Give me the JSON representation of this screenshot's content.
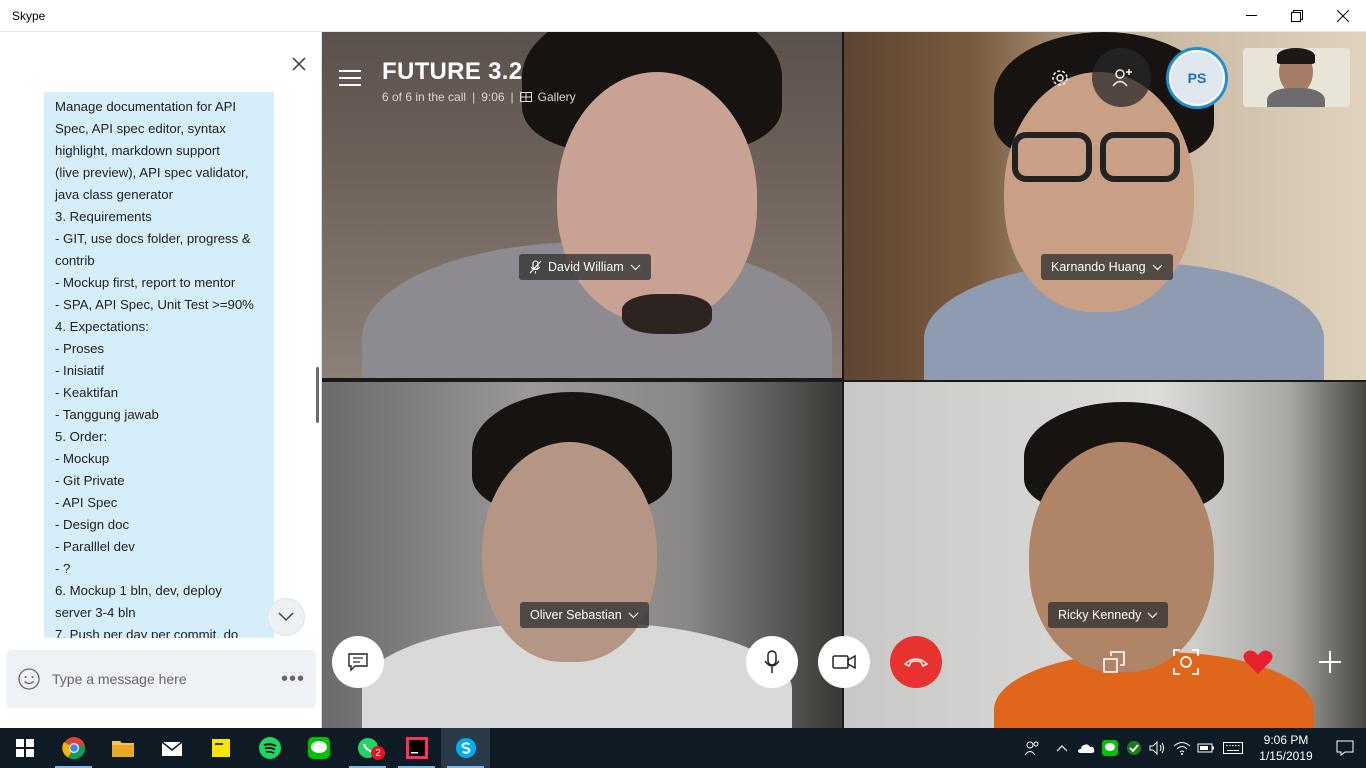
{
  "window": {
    "title": "Skype",
    "controls": {
      "minimize": "minimize-icon",
      "restore": "restore-icon",
      "close": "close-icon"
    }
  },
  "chat": {
    "message_lines": [
      "Manage documentation for API",
      "Spec, API spec editor, syntax",
      "highlight, markdown support",
      "(live preview), API spec validator,",
      "java class generator",
      "3. Requirements",
      "- GIT, use docs folder, progress &",
      "contrib",
      "- Mockup first, report to mentor",
      "- SPA, API Spec, Unit Test >=90%",
      "4. Expectations:",
      "- Proses",
      "- Inisiatif",
      "- Keaktifan",
      "- Tanggung jawab",
      "5. Order:",
      "- Mockup",
      "- Git Private",
      "- API Spec",
      "- Design doc",
      "- Paralllel dev",
      "- ?",
      "6. Mockup 1 bln, dev, deploy",
      "server 3-4 bln",
      "7. Push per day per commit, do"
    ],
    "composer_placeholder": "Type a message here",
    "more_label": "•••"
  },
  "call": {
    "title": "FUTURE 3.2",
    "status": "6 of 6 in the call | 9:06",
    "separator": "|",
    "status_count": "6 of 6 in the call",
    "status_time": "9:06",
    "view_mode": "Gallery",
    "avatar_initials": "PS",
    "participants": [
      {
        "name": "David William",
        "muted": true
      },
      {
        "name": "Karnando Huang",
        "muted": false
      },
      {
        "name": "Oliver Sebastian",
        "muted": false
      },
      {
        "name": "Ricky Kennedy",
        "muted": false
      }
    ]
  },
  "taskbar": {
    "apps": [
      "start-icon",
      "chrome-icon",
      "file-explorer-icon",
      "mail-icon",
      "sticky-notes-icon",
      "spotify-icon",
      "line-icon",
      "whatsapp-icon",
      "intellij-icon",
      "skype-icon"
    ],
    "whatsapp_badge": "2",
    "time": "9:06 PM",
    "date": "1/15/2019"
  },
  "colors": {
    "chat_bubble": "#d5eefa",
    "end_call": "#e8322f",
    "heart": "#e8212e",
    "taskbar": "#0e1a24"
  }
}
